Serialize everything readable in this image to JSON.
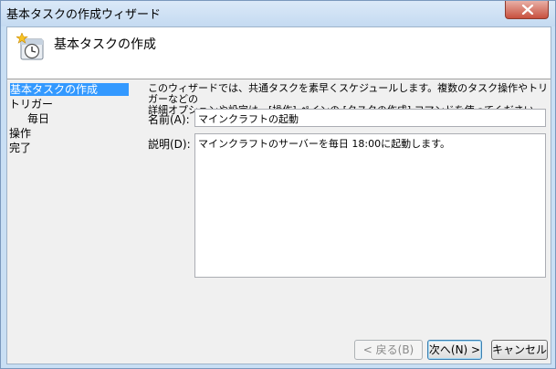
{
  "window": {
    "title": "基本タスクの作成ウィザード",
    "close_icon": "close-icon"
  },
  "header": {
    "title": "基本タスクの作成",
    "icon": "task-clock-icon"
  },
  "steps": [
    {
      "label": "基本タスクの作成",
      "active": true
    },
    {
      "label": "トリガー",
      "active": false
    },
    {
      "label": "毎日",
      "active": false
    },
    {
      "label": "操作",
      "active": false
    },
    {
      "label": "完了",
      "active": false
    }
  ],
  "main": {
    "description_line1": "このウィザードでは、共通タスクを素早くスケジュールします。複数のタスク操作やトリガーなどの",
    "description_line2": "詳細オプションや設定は、[操作] ペインの [タスクの作成] コマンドを使ってください。",
    "name_label": "名前(A):",
    "name_value": "マインクラフトの起動",
    "desc_label": "説明(D):",
    "desc_value": "マインクラフトのサーバーを毎日 18:00に起動します。"
  },
  "buttons": {
    "back": "< 戻る(B)",
    "next": "次へ(N) >",
    "cancel": "キャンセル"
  }
}
